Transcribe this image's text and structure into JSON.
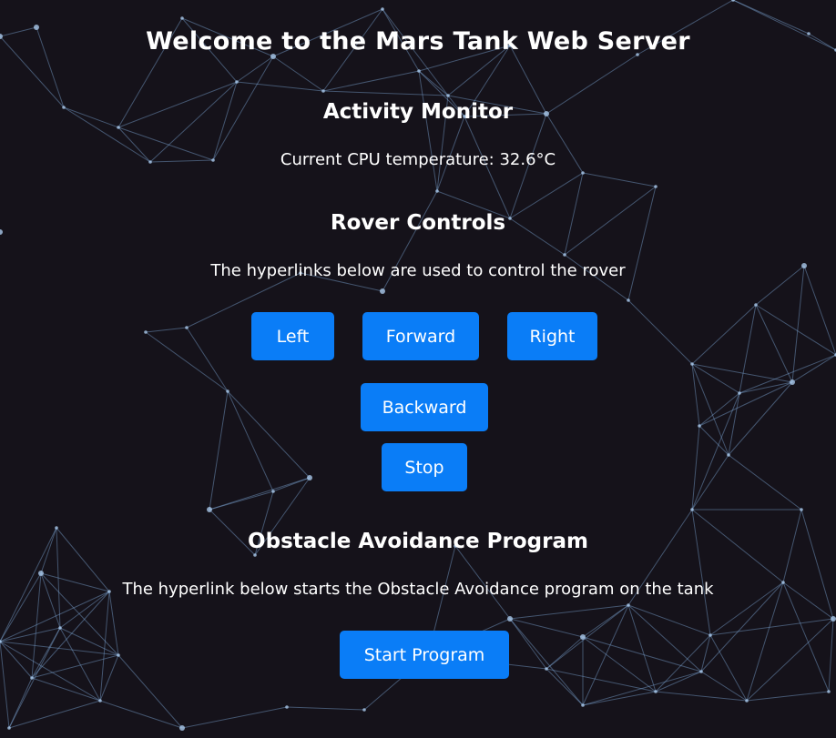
{
  "page": {
    "title": "Welcome to the Mars Tank Web Server",
    "background_color": "#15121a",
    "button_color": "#0a7df7",
    "network_line_color": "#7fa8d6"
  },
  "activity_monitor": {
    "heading": "Activity Monitor",
    "cpu_text": "Current CPU temperature: 32.6°C"
  },
  "rover_controls": {
    "heading": "Rover Controls",
    "description": "The hyperlinks below are used to control the rover",
    "left_label": "Left",
    "forward_label": "Forward",
    "right_label": "Right",
    "backward_label": "Backward",
    "stop_label": "Stop"
  },
  "obstacle_avoidance": {
    "heading": "Obstacle Avoidance Program",
    "description": "The hyperlink below starts the Obstacle Avoidance program on the tank",
    "start_label": "Start Program"
  }
}
